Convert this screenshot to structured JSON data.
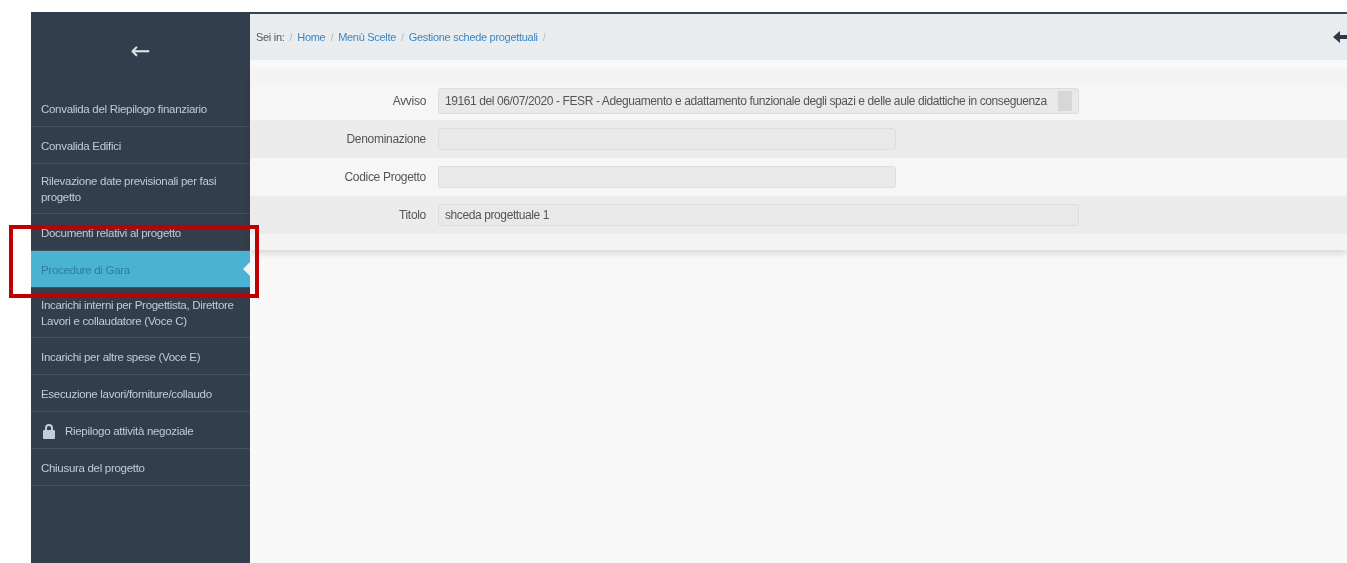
{
  "sidebar": {
    "back": "←",
    "items": [
      {
        "label": "Convalida del Riepilogo finanziario",
        "selected": false,
        "locked": false
      },
      {
        "label": "Convalida Edifici",
        "selected": false,
        "locked": false
      },
      {
        "label": "Rilevazione date previsionali per fasi progetto",
        "selected": false,
        "locked": false
      },
      {
        "label": "Documenti relativi al progetto",
        "selected": false,
        "locked": false
      },
      {
        "label": "Procedure di Gara",
        "selected": true,
        "locked": false
      },
      {
        "label": "Incarichi interni per Progettista, Direttore Lavori e collaudatore (Voce C)",
        "selected": false,
        "locked": false
      },
      {
        "label": "Incarichi per altre spese (Voce E)",
        "selected": false,
        "locked": false
      },
      {
        "label": "Esecuzione lavori/forniture/collaudo",
        "selected": false,
        "locked": false
      },
      {
        "label": "Riepilogo attività negoziale",
        "selected": false,
        "locked": true
      },
      {
        "label": "Chiusura del progetto",
        "selected": false,
        "locked": false
      }
    ]
  },
  "breadcrumb": {
    "prefix": "Sei in:",
    "separator": "/",
    "links": [
      "Home",
      "Menù Scelte",
      "Gestione schede progettuali"
    ]
  },
  "form": {
    "fields": [
      {
        "label": "Avviso",
        "kind": "textarea",
        "value": "19161 del 06/07/2020 - FESR - Adeguamento e adattamento funzionale degli spazi e delle aule didattiche in conseguenza"
      },
      {
        "label": "Denominazione",
        "kind": "short"
      },
      {
        "label": "Codice Progetto",
        "kind": "short"
      },
      {
        "label": "Titolo",
        "kind": "long",
        "value": "shceda progettuale 1"
      }
    ]
  }
}
